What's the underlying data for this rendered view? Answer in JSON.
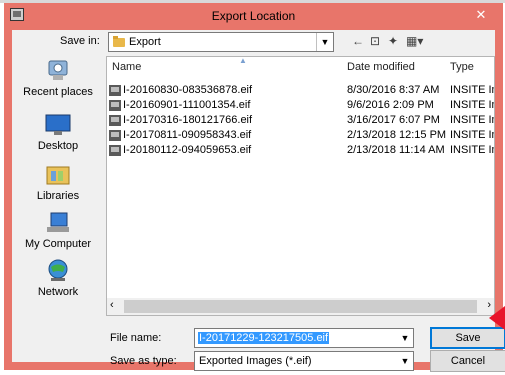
{
  "window": {
    "title": "Export Location",
    "close_glyph": "✕"
  },
  "toolbar": {
    "save_in_label": "Save in:",
    "save_in_value": "Export",
    "icons": [
      "back-arrow-icon",
      "up-folder-icon",
      "new-folder-icon",
      "view-menu-icon"
    ]
  },
  "places": [
    {
      "label": "Recent places",
      "icon": "recent-places-icon"
    },
    {
      "label": "Desktop",
      "icon": "desktop-icon"
    },
    {
      "label": "Libraries",
      "icon": "libraries-icon"
    },
    {
      "label": "My Computer",
      "icon": "computer-icon"
    },
    {
      "label": "Network",
      "icon": "network-icon"
    }
  ],
  "file_list": {
    "columns": [
      "Name",
      "Date modified",
      "Type"
    ],
    "rows": [
      {
        "name": "I-20160830-083536878.eif",
        "date": "8/30/2016 8:37 AM",
        "type": "INSITE Im"
      },
      {
        "name": "I-20160901-111001354.eif",
        "date": "9/6/2016 2:09 PM",
        "type": "INSITE Im"
      },
      {
        "name": "I-20170316-180121766.eif",
        "date": "3/16/2017 6:07 PM",
        "type": "INSITE Im"
      },
      {
        "name": "I-20170811-090958343.eif",
        "date": "2/13/2018 12:15 PM",
        "type": "INSITE Im"
      },
      {
        "name": "I-20180112-094059653.eif",
        "date": "2/13/2018 11:14 AM",
        "type": "INSITE Im"
      }
    ]
  },
  "footer": {
    "file_name_label": "File name:",
    "file_name_value": "I-20171229-123217505.eif",
    "save_type_label": "Save as type:",
    "save_type_value": "Exported Images (*.eif)",
    "save_button": "Save",
    "cancel_button": "Cancel"
  },
  "colors": {
    "frame": "#e8756a",
    "selection": "#3399ff",
    "arrow": "#e8152b"
  }
}
